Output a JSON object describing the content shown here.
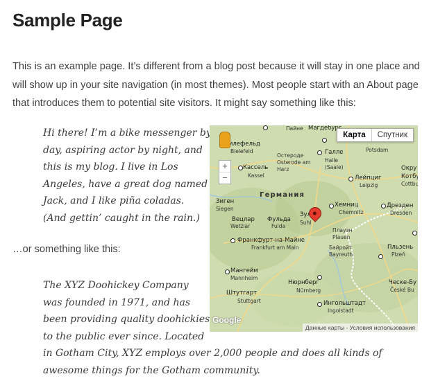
{
  "page": {
    "title": "Sample Page",
    "intro": "This is an example page. It’s different from a blog post because it will stay in one place and will show up in your site navigation (in most themes). Most people start with an About page that introduces them to potential site visitors. It might say something like this:",
    "quote1_lines": [
      "Hi there! I’m a bike messenger by",
      "day, aspiring actor by night, and",
      "this is my blog. I live in Los",
      "Angeles, have a great dog named",
      "Jack, and I like piña coladas.",
      "(And gettin’ caught in the rain.)"
    ],
    "separator": "…or something like this:",
    "quote2_lines": [
      "The XYZ Doohickey Company",
      "was founded in 1971, and has",
      "been providing quality doohickies",
      "to the public ever since. Located",
      "in Gotham City, XYZ employs over 2,000 people and does all kinds of",
      "awesome things for the Gotham community."
    ]
  },
  "map": {
    "map_type_buttons": [
      "Карта",
      "Спутник"
    ],
    "active_map_type": "Карта",
    "zoom_in": "+",
    "zoom_out": "−",
    "logo": "Google",
    "attribution_data": "Данные карты",
    "attribution_sep": " - ",
    "attribution_terms": "Условия использования",
    "country_label": "Германия",
    "city_labels": [
      {
        "name": "Билефельд",
        "sub": "Bielefeld"
      },
      {
        "name": "Пайне",
        "sub": ""
      },
      {
        "name": "Магдебург",
        "sub": ""
      },
      {
        "name": "Остероде",
        "sub": "Osterode am Harz"
      },
      {
        "name": "Кассель",
        "sub": "Kassel"
      },
      {
        "name": "Галле",
        "sub": "Halle (Saale)"
      },
      {
        "name": "Потсдам",
        "sub": "Potsdam"
      },
      {
        "name": "Лейпциг",
        "sub": "Leipzig"
      },
      {
        "name": "Окру",
        "sub": ""
      },
      {
        "name": "Котбу",
        "sub": "Cottbu"
      },
      {
        "name": "Зиген",
        "sub": "Siegen"
      },
      {
        "name": "Вецлар",
        "sub": "Wetzlar"
      },
      {
        "name": "Фульда",
        "sub": "Fulda"
      },
      {
        "name": "Зуль",
        "sub": "Suhl"
      },
      {
        "name": "Хемниц",
        "sub": "Chemnitz"
      },
      {
        "name": "Дрезден",
        "sub": "Dresden"
      },
      {
        "name": "Плауэн",
        "sub": "Plauen"
      },
      {
        "name": "Франкфурт-на-Майне",
        "sub": "Frankfurt am Main"
      },
      {
        "name": "Байройт",
        "sub": "Bayreuth"
      },
      {
        "name": "Пльзень",
        "sub": "Plzeň"
      },
      {
        "name": "Мангейм",
        "sub": "Mannheim"
      },
      {
        "name": "Нюрнберг",
        "sub": "Nürnberg"
      },
      {
        "name": "Штутгарт",
        "sub": "Stuttgart"
      },
      {
        "name": "Ингольштадт",
        "sub": "Ingolstadt"
      },
      {
        "name": "Ческе-Бу",
        "sub": "České Bu"
      }
    ]
  }
}
